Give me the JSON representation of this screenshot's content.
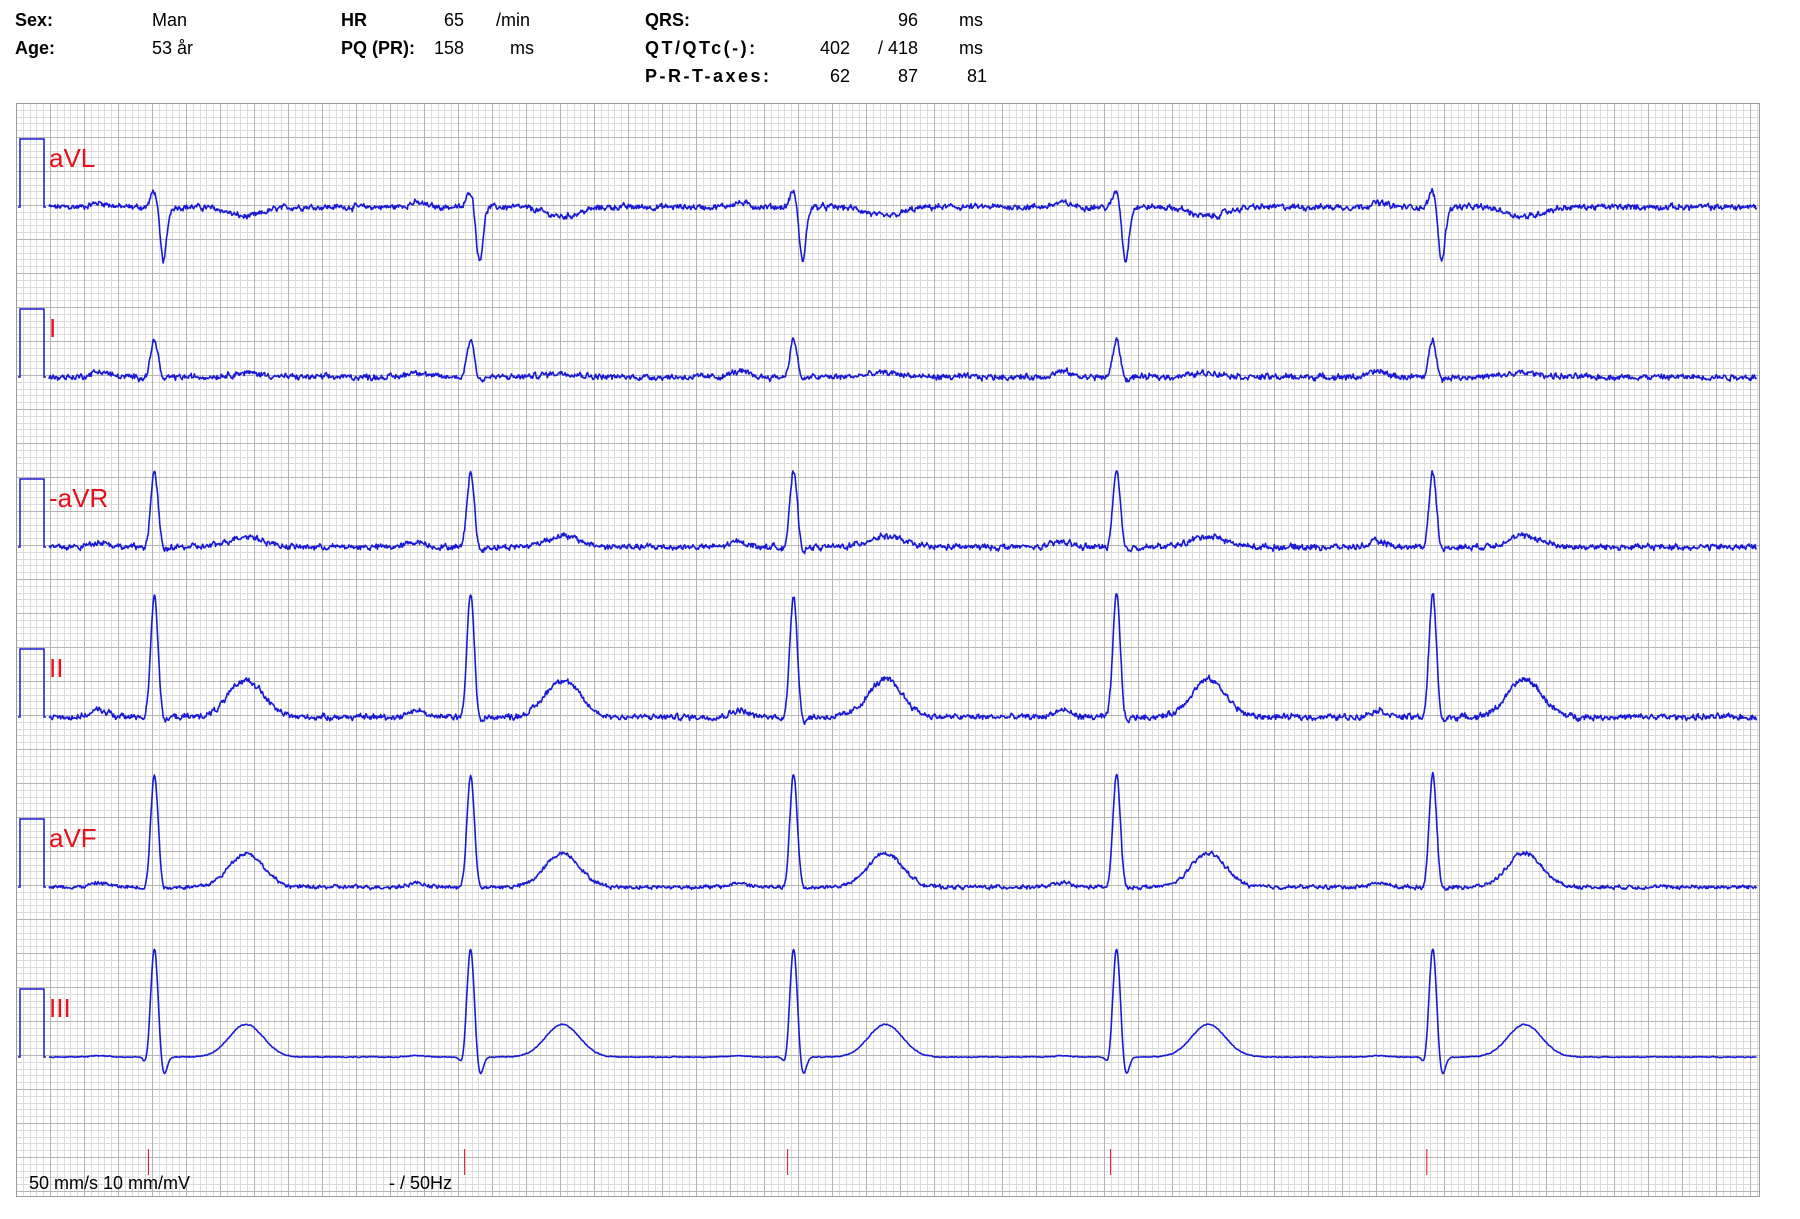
{
  "header": {
    "sex_label": "Sex:",
    "sex_value": "Man",
    "age_label": "Age:",
    "age_value": "53 år",
    "hr_label": "HR",
    "hr_value": "65",
    "hr_unit": "/min",
    "pq_label": "PQ (PR):",
    "pq_value": "158",
    "pq_unit": "ms",
    "qrs_label": "QRS:",
    "qrs_value": "96",
    "qrs_unit": "ms",
    "qt_label": "QT/QTc(-):",
    "qt_value": "402",
    "qtc_value": "/ 418",
    "qt_unit": "ms",
    "axes_label": "P-R-T-axes:",
    "p_axis": "62",
    "r_axis": "87",
    "t_axis": "81"
  },
  "footer": {
    "speed_gain": "50 mm/s 10 mm/mV",
    "filter": "- / 50Hz"
  },
  "colors": {
    "trace": "#1a1ad6",
    "lead_label": "#e8101c",
    "grid_minor": "#dcdcdc",
    "grid_major": "#b4b4b4",
    "beat_marker": "#e8101c"
  },
  "chart_data": {
    "type": "line",
    "title": "",
    "paper_speed_mm_s": 50,
    "gain_mm_mV": 10,
    "lead_order": [
      "aVL",
      "I",
      "-aVR",
      "II",
      "aVF",
      "III"
    ],
    "beat_times_s": [
      0.31,
      1.24,
      2.19,
      3.14,
      4.07
    ],
    "leads": [
      {
        "name": "aVL",
        "q": -0.02,
        "r": 0.25,
        "s": -0.8,
        "p": 0.06,
        "t": -0.14,
        "noise": 0.06
      },
      {
        "name": "I",
        "q": -0.02,
        "r": 0.55,
        "s": -0.06,
        "p": 0.08,
        "t": 0.06,
        "noise": 0.06
      },
      {
        "name": "-aVR",
        "q": -0.04,
        "r": 1.1,
        "s": -0.08,
        "p": 0.08,
        "t": 0.16,
        "noise": 0.06
      },
      {
        "name": "II",
        "q": -0.05,
        "r": 1.8,
        "s": -0.1,
        "p": 0.1,
        "t": 0.55,
        "noise": 0.06
      },
      {
        "name": "aVF",
        "q": -0.06,
        "r": 1.65,
        "s": -0.05,
        "p": 0.06,
        "t": 0.5,
        "noise": 0.04
      },
      {
        "name": "III",
        "q": -0.15,
        "r": 1.6,
        "s": -0.3,
        "p": 0.02,
        "t": 0.48,
        "noise": 0.01
      }
    ],
    "grid": true
  }
}
